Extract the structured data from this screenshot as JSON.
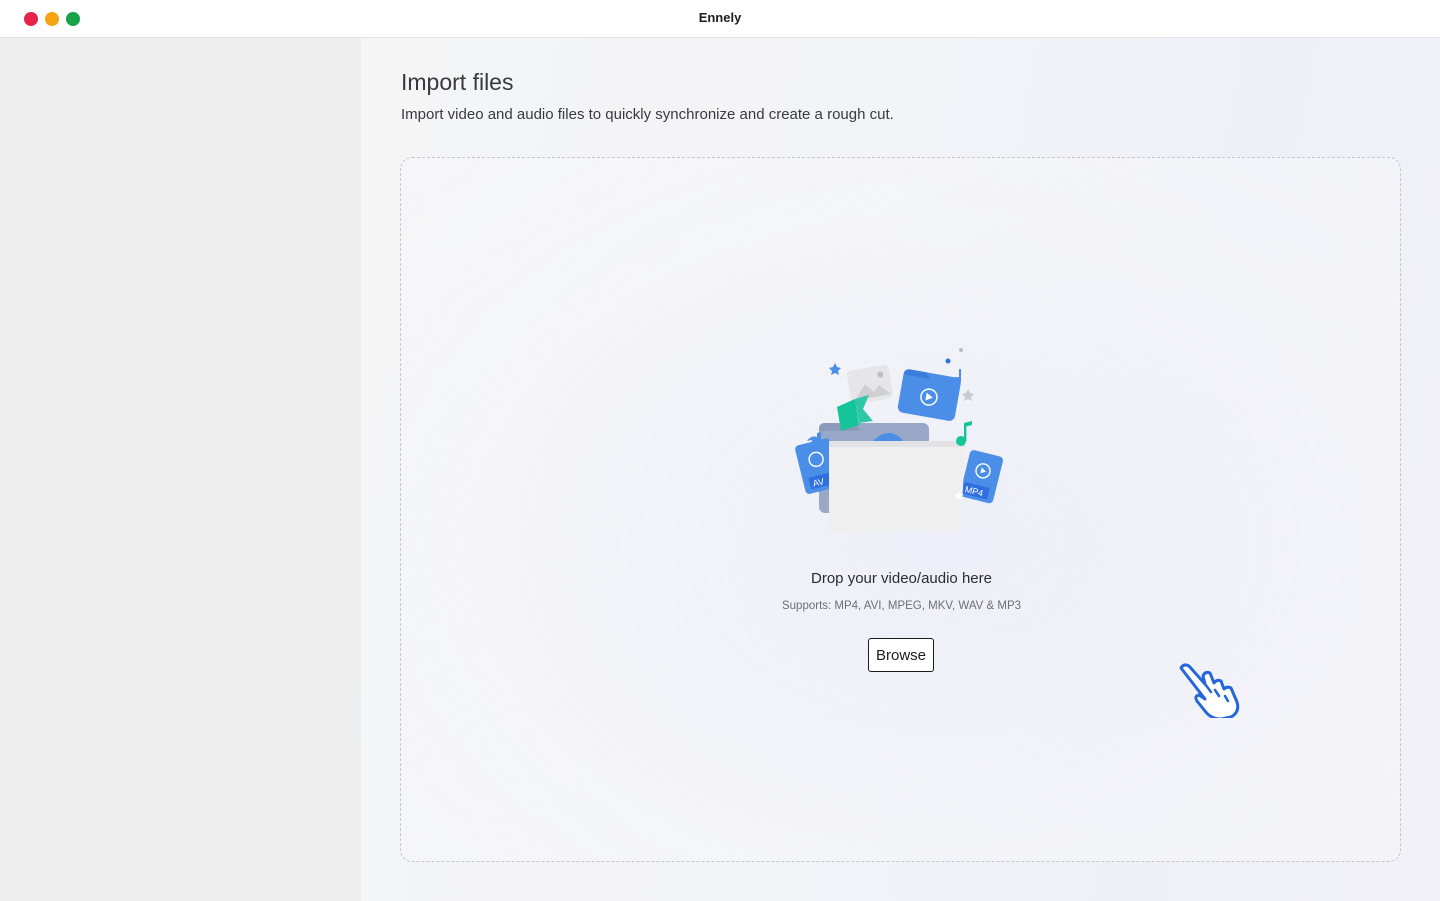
{
  "window": {
    "title": "Ennely",
    "controls": [
      "close",
      "minimize",
      "maximize"
    ]
  },
  "main": {
    "title": "Import files",
    "subtitle": "Import video and audio files to quickly synchronize and create a rough cut.",
    "dropzone": {
      "illustration_icon": "folder-with-media-files-icon",
      "badge_avi": "AV",
      "badge_mp4": "MP4",
      "prompt": "Drop your video/audio here",
      "supports": "Supports: MP4, AVI, MPEG, MKV, WAV & MP3",
      "browse_label": "Browse",
      "cursor_icon": "hand-pointer-icon"
    }
  },
  "colors": {
    "close": "#e8234a",
    "minimize": "#f6a312",
    "maximize": "#16a34a",
    "accent_blue": "#2f6fe0",
    "accent_green": "#16c49a"
  }
}
